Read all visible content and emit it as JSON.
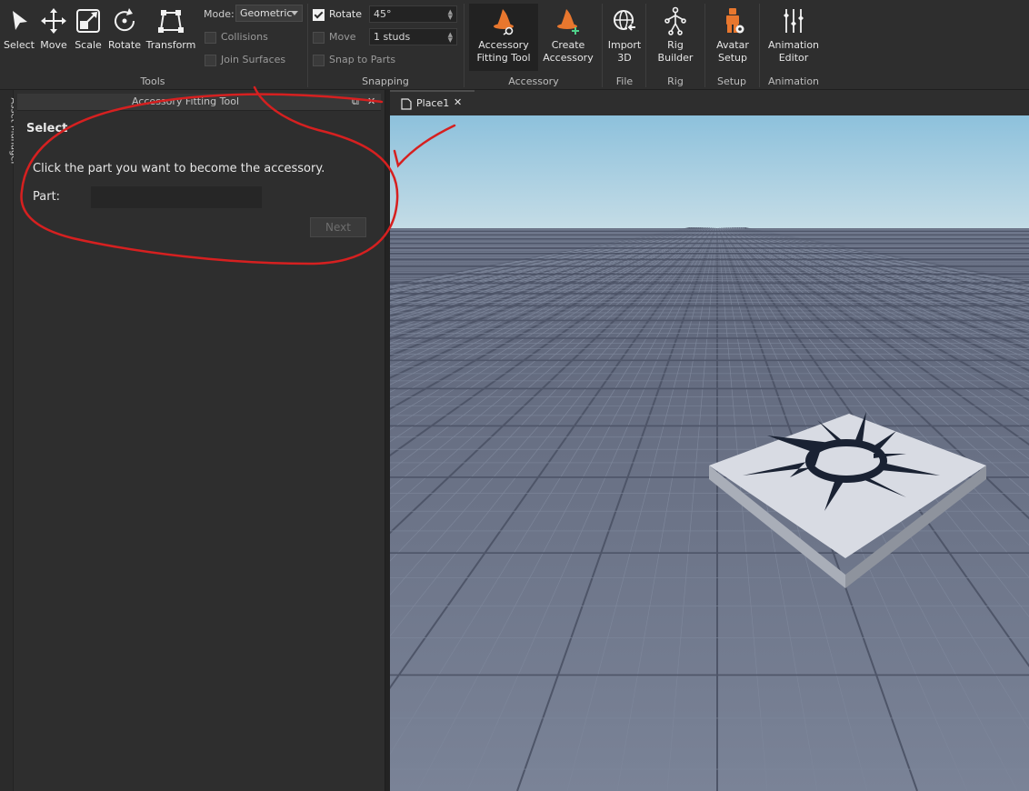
{
  "toolbar": {
    "tools": [
      {
        "label": "Select",
        "icon": "cursor-arrow-icon"
      },
      {
        "label": "Move",
        "icon": "move-arrows-icon"
      },
      {
        "label": "Scale",
        "icon": "scale-box-icon"
      },
      {
        "label": "Rotate",
        "icon": "rotate-circle-icon"
      },
      {
        "label": "Transform",
        "icon": "transform-frame-icon"
      }
    ],
    "mode_label": "Mode:",
    "mode_value": "Geometric",
    "collisions_label": "Collisions",
    "join_surfaces_label": "Join Surfaces",
    "tools_group_label": "Tools",
    "rotate_label": "Rotate",
    "rotate_value": "45°",
    "move_label": "Move",
    "move_value": "1 studs",
    "snap_to_parts_label": "Snap to Parts",
    "snapping_group_label": "Snapping",
    "accessory_buttons": [
      {
        "label1": "Accessory",
        "label2": "Fitting Tool",
        "icon": "witch-hat-fitting-icon"
      },
      {
        "label1": "Create",
        "label2": "Accessory",
        "icon": "witch-hat-plus-icon"
      }
    ],
    "accessory_group_label": "Accessory",
    "import_label1": "Import",
    "import_label2": "3D",
    "file_group_label": "File",
    "rig_label1": "Rig",
    "rig_label2": "Builder",
    "rig_group_label": "Rig",
    "avatar_label1": "Avatar",
    "avatar_label2": "Setup",
    "setup_group_label": "Setup",
    "anim_label1": "Animation",
    "anim_label2": "Editor",
    "animation_group_label": "Animation"
  },
  "side_tab": {
    "label": "Asset Manager"
  },
  "panel": {
    "title": "Accessory Fitting Tool",
    "section_title": "Select",
    "instruction": "Click the part you want to become the accessory.",
    "part_label": "Part:",
    "part_value": "",
    "next_label": "Next"
  },
  "viewport": {
    "tab_label": "Place1"
  },
  "colors": {
    "accent_orange": "#e8772e",
    "annotation_red": "#d62020",
    "sky_top": "#8dc1dc",
    "ground": "#6b7589"
  }
}
